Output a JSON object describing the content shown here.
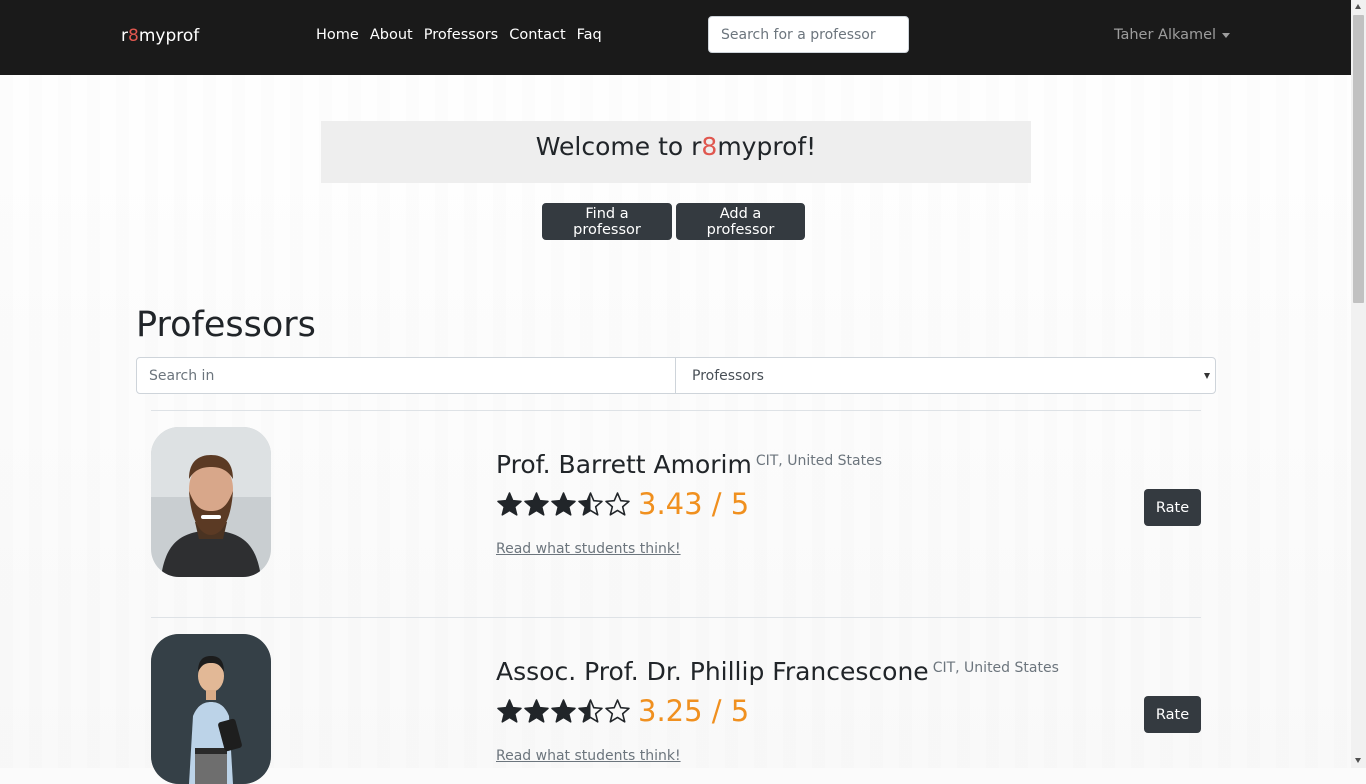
{
  "nav": {
    "brand_prefix": "r",
    "brand_eight": "8",
    "brand_suffix": "myprof",
    "links": [
      "Home",
      "About",
      "Professors",
      "Contact",
      "Faq"
    ],
    "search_placeholder": "Search for a professor",
    "user": "Taher Alkamel"
  },
  "welcome": {
    "prefix": "Welcome to r",
    "eight": "8",
    "suffix": "myprof!"
  },
  "buttons": {
    "find": "Find a professor",
    "add": "Add a professor"
  },
  "professors_section": {
    "title": "Professors",
    "search_placeholder": "Search in",
    "select_value": "Professors"
  },
  "professors": [
    {
      "name": "Prof. Barrett Amorim",
      "location": "CIT, United States",
      "rating": 3.43,
      "rating_text": "3.43 / 5",
      "read_link": "Read what students think!",
      "rate_label": "Rate"
    },
    {
      "name": "Assoc. Prof. Dr. Phillip Francescone",
      "location": "CIT, United States",
      "rating": 3.25,
      "rating_text": "3.25 / 5",
      "read_link": "Read what students think!",
      "rate_label": "Rate"
    }
  ],
  "colors": {
    "navbar": "#1a1a1a",
    "accent_red": "#e0574f",
    "rating_orange": "#f0901f",
    "button_dark": "#343a40"
  }
}
